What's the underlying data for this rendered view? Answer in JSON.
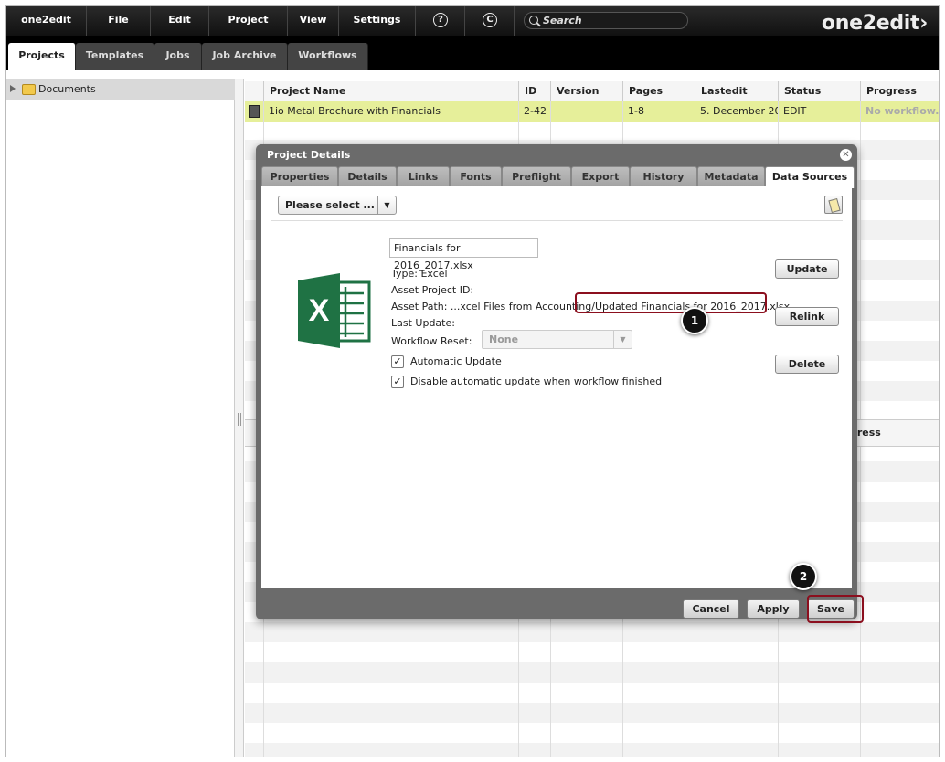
{
  "menu": {
    "app": "one2edit",
    "file": "File",
    "edit": "Edit",
    "project": "Project",
    "view": "View",
    "settings": "Settings",
    "help_glyph": "?",
    "refresh_glyph": "C",
    "search_placeholder": "Search",
    "logo": "one2edit›"
  },
  "tabs": [
    "Projects",
    "Templates",
    "Jobs",
    "Job Archive",
    "Workflows"
  ],
  "tree": {
    "root": "Documents"
  },
  "grid": {
    "columns": [
      "Project Name",
      "ID",
      "Version",
      "Pages",
      "Lastedit",
      "Status",
      "Progress"
    ],
    "row": {
      "name": "1io Metal Brochure with Financials",
      "id": "2-42",
      "version": "",
      "pages": "1-8",
      "lastedit": "5. December 20",
      "status": "EDIT",
      "progress": "No workflow."
    },
    "lower_progress_fragment": "gress"
  },
  "dialog": {
    "title": "Project Details",
    "close_glyph": "✕",
    "tabs": [
      "Properties",
      "Details",
      "Links",
      "Fonts",
      "Preflight",
      "Export",
      "History",
      "Metadata",
      "Data Sources"
    ],
    "select_placeholder": "Please select ...",
    "file_name": "Financials for 2016_2017.xlsx",
    "type_label": "Type: Excel",
    "asset_project_id_label": "Asset Project ID:",
    "asset_path_label": "Asset Path: ...xcel Files from Accounting",
    "asset_path_highlight": "/Updated Financials for 2016_2017.xlsx",
    "last_update_label": "Last Update:",
    "workflow_reset_label": "Workflow Reset:",
    "workflow_reset_value": "None",
    "automatic_update_label": "Automatic Update",
    "disable_update_label": "Disable automatic update when workflow finished",
    "check_glyph": "✓",
    "update_button": "Update",
    "relink_button": "Relink",
    "delete_button": "Delete",
    "cancel_button": "Cancel",
    "apply_button": "Apply",
    "save_button": "Save"
  },
  "callouts": [
    "1",
    "2"
  ],
  "colors": {
    "accent_highlight": "#8b0f1e",
    "row_selected": "#e6ef9a",
    "excel_green": "#1f7244"
  }
}
